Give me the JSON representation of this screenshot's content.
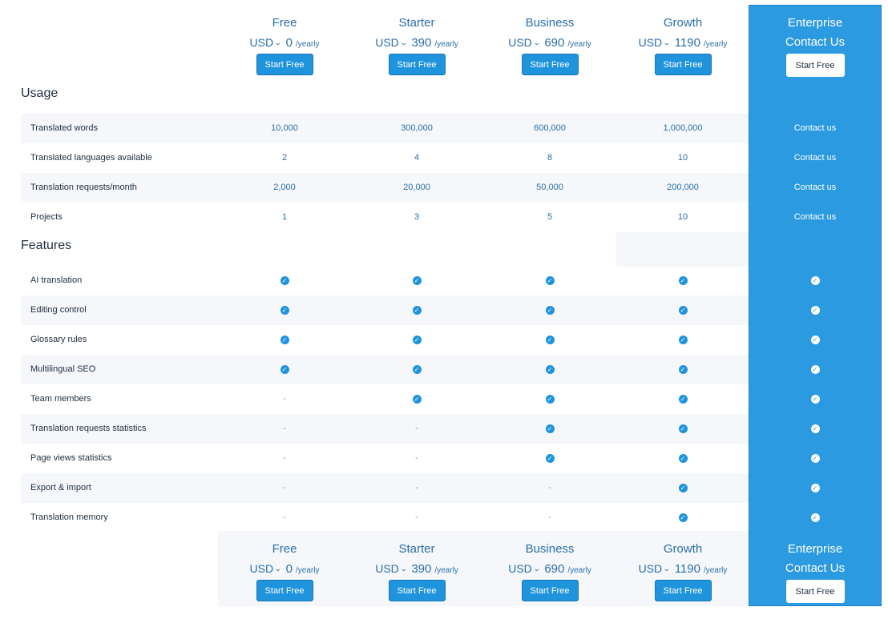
{
  "plans": [
    {
      "name": "Free",
      "currency": "USD",
      "chevron": "⌄",
      "amount": "0",
      "period": "/yearly",
      "button": "Start Free"
    },
    {
      "name": "Starter",
      "currency": "USD",
      "chevron": "⌄",
      "amount": "390",
      "period": "/yearly",
      "button": "Start Free"
    },
    {
      "name": "Business",
      "currency": "USD",
      "chevron": "⌄",
      "amount": "690",
      "period": "/yearly",
      "button": "Start Free"
    },
    {
      "name": "Growth",
      "currency": "USD",
      "chevron": "⌄",
      "amount": "1190",
      "period": "/yearly",
      "button": "Start Free"
    }
  ],
  "enterprise": {
    "name": "Enterprise",
    "contact": "Contact Us",
    "button": "Start Free",
    "cell_text": "Contact us"
  },
  "usage": {
    "title": "Usage",
    "rows": [
      {
        "label": "Translated words",
        "values": [
          "10,000",
          "300,000",
          "600,000",
          "1,000,000"
        ]
      },
      {
        "label": "Translated languages available",
        "values": [
          "2",
          "4",
          "8",
          "10"
        ]
      },
      {
        "label": "Translation requests/month",
        "values": [
          "2,000",
          "20,000",
          "50,000",
          "200,000"
        ]
      },
      {
        "label": "Projects",
        "values": [
          "1",
          "3",
          "5",
          "10"
        ]
      }
    ]
  },
  "features": {
    "title": "Features",
    "check_glyph": "✓",
    "dash": "-",
    "rows": [
      {
        "label": "AI translation",
        "values": [
          true,
          true,
          true,
          true
        ]
      },
      {
        "label": "Editing control",
        "values": [
          true,
          true,
          true,
          true
        ]
      },
      {
        "label": "Glossary rules",
        "values": [
          true,
          true,
          true,
          true
        ]
      },
      {
        "label": "Multilingual SEO",
        "values": [
          true,
          true,
          true,
          true
        ]
      },
      {
        "label": "Team members",
        "values": [
          false,
          true,
          true,
          true
        ]
      },
      {
        "label": "Translation requests statistics",
        "values": [
          false,
          false,
          true,
          true
        ]
      },
      {
        "label": "Page views statistics",
        "values": [
          false,
          false,
          true,
          true
        ]
      },
      {
        "label": "Export & import",
        "values": [
          false,
          false,
          false,
          true
        ]
      },
      {
        "label": "Translation memory",
        "values": [
          false,
          false,
          false,
          true
        ]
      }
    ]
  },
  "colors": {
    "accent": "#2b9ae0",
    "button": "#1f94dd",
    "row_alt": "#f5f7fb",
    "plan_text": "#2a6fa8"
  }
}
